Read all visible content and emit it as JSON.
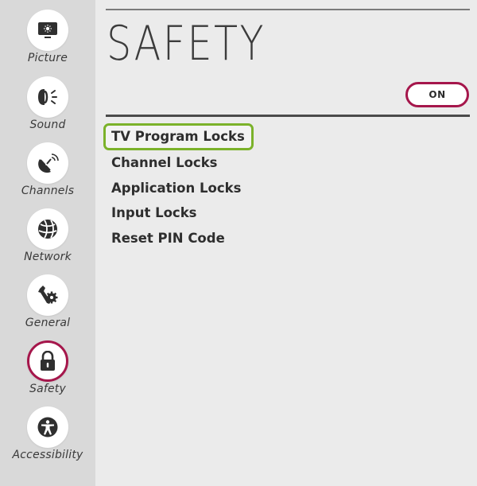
{
  "sidebar": {
    "items": [
      {
        "label": "Picture",
        "icon": "picture-icon"
      },
      {
        "label": "Sound",
        "icon": "sound-icon"
      },
      {
        "label": "Channels",
        "icon": "channels-icon"
      },
      {
        "label": "Network",
        "icon": "network-icon"
      },
      {
        "label": "General",
        "icon": "general-icon"
      },
      {
        "label": "Safety",
        "icon": "lock-icon",
        "active": true
      },
      {
        "label": "Accessibility",
        "icon": "accessibility-icon"
      }
    ]
  },
  "main": {
    "title": "SAFETY",
    "toggle_label": "ON",
    "menu": [
      {
        "label": "TV Program Locks",
        "focused": true
      },
      {
        "label": "Channel Locks"
      },
      {
        "label": "Application Locks"
      },
      {
        "label": "Input Locks"
      },
      {
        "label": "Reset PIN Code"
      }
    ]
  },
  "colors": {
    "accent": "#a5164b",
    "focus": "#7bb22a",
    "sidebar_bg": "#d9d9d9",
    "main_bg": "#ebebeb"
  }
}
